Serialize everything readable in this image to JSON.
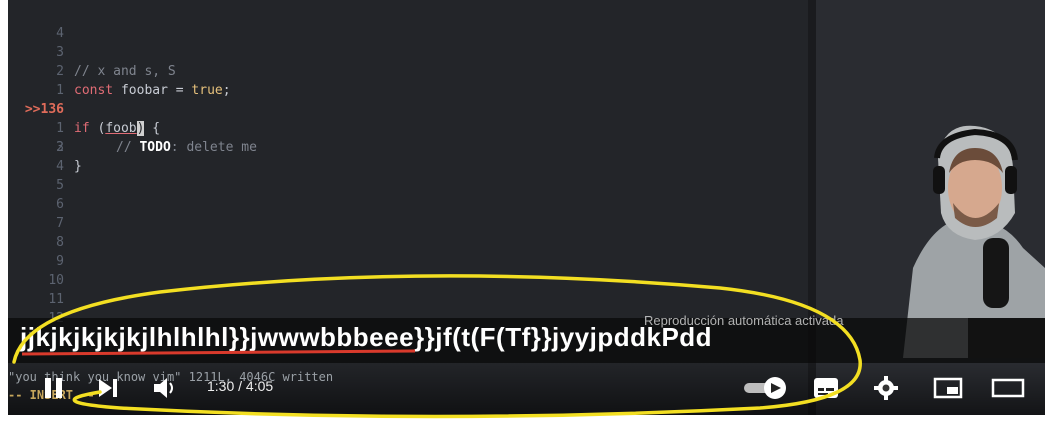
{
  "editor": {
    "lines": [
      {
        "num": "4",
        "text": ""
      },
      {
        "num": "3",
        "text": "// x and s, S"
      },
      {
        "num": "2",
        "text_parts": [
          "const",
          " foobar ",
          "=",
          " true",
          ";"
        ]
      },
      {
        "num": "1",
        "text": ""
      },
      {
        "num": "136",
        "marker": ">>",
        "current": true
      },
      {
        "num": "1",
        "text": "    // TODO: delete me"
      },
      {
        "num": "2",
        "text": "}"
      },
      {
        "num": "3"
      },
      {
        "num": "4"
      },
      {
        "num": "5"
      },
      {
        "num": "6"
      },
      {
        "num": "7"
      },
      {
        "num": "8"
      },
      {
        "num": "9"
      },
      {
        "num": "10"
      },
      {
        "num": "11"
      },
      {
        "num": "12"
      }
    ],
    "current_line": {
      "keyword": "if",
      "open": " (",
      "word": "foob",
      "cursor": ")",
      "rest": " {"
    },
    "comment_prefix": "// ",
    "comment_todo": "TODO",
    "comment_rest": ": delete me",
    "line3_comment": "// x and s, S",
    "line2": {
      "kw": "const",
      "name": " foobar ",
      "op": "=",
      "val": " true",
      "semi": ";"
    },
    "brace": "}"
  },
  "caption": {
    "text": "jjkjkjkjkjkjlhlhlhl}}jwwwbbbeee}}jf(t(F(Tf}}jyyjpddkPdd"
  },
  "autoplay_label": "Reproducción automática activada",
  "vim": {
    "status": "\"you think you know vim\" 1211L, 4046C written",
    "mode": "-- INSERT --"
  },
  "player": {
    "current_time": "1:30",
    "duration": "4:05",
    "time_separator": " / ",
    "autoplay_on": true
  },
  "icons": {
    "pause": "pause-icon",
    "next": "skip-next-icon",
    "volume": "volume-icon",
    "autoplay": "autoplay-toggle-icon",
    "subtitles": "subtitles-icon",
    "settings": "gear-icon",
    "miniplayer": "miniplayer-icon",
    "theater": "theater-mode-icon"
  },
  "colors": {
    "editor_bg": "#232529",
    "accent_red": "#e06c5a",
    "annotation_yellow": "#f3df22"
  }
}
